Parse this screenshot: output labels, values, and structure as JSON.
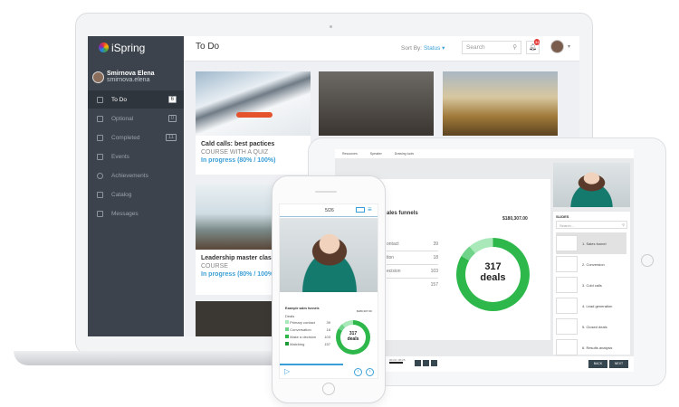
{
  "app": {
    "logo": "iSpring",
    "page_title": "To Do"
  },
  "user": {
    "name": "Smirnova Elena",
    "login": "smirnova.elena"
  },
  "sidebar": {
    "items": [
      {
        "label": "To Do",
        "count": "6",
        "icon": "clipboard-icon"
      },
      {
        "label": "Optional",
        "count": "0",
        "icon": "document-icon"
      },
      {
        "label": "Completed",
        "count": "11",
        "icon": "checkbox-icon"
      },
      {
        "label": "Events",
        "icon": "calendar-icon"
      },
      {
        "label": "Achievements",
        "icon": "medal-icon"
      },
      {
        "label": "Catalog",
        "icon": "catalog-icon"
      },
      {
        "label": "Messages",
        "icon": "envelope-icon"
      }
    ]
  },
  "header": {
    "sort_label": "Sort By:",
    "sort_value": "Status",
    "search_placeholder": "Search",
    "notifications": "34"
  },
  "cards": [
    {
      "title": "Cald calls: best pactices",
      "type": "COURSE WITH A QUIZ",
      "progress": "In progress (80% / 100%)"
    },
    {
      "title": "Leadership master class",
      "type": "COURSE",
      "progress": "In progress (80% / 100%)"
    }
  ],
  "tablet": {
    "tabs": [
      "Resources",
      "Speaker",
      "Drawing tools"
    ],
    "slide_title": "ales funnels",
    "amount": "$180,307.00",
    "rows": [
      {
        "label": "ontact",
        "value": "39"
      },
      {
        "label": "tion",
        "value": "18"
      },
      {
        "label": "ecision",
        "value": "103"
      },
      {
        "label": "",
        "value": "157"
      }
    ],
    "donut": {
      "number": "317",
      "label": "deals"
    },
    "slides_heading": "SLIDES",
    "slides_search": "Search...",
    "slides": [
      "1. Sales funnel",
      "2. Conversion",
      "3. Cold calls",
      "4. Lead generation",
      "5. Closed deals",
      "6. Results analysis"
    ],
    "time": "00:20 / 00:25",
    "back": "BACK",
    "next": "NEXT"
  },
  "phone": {
    "counter": "5/26",
    "slide_title": "Example sales funnels",
    "amount": "$180,307.00",
    "section": "Deals",
    "rows": [
      "Primary contact",
      "Conversation",
      "Make a decision",
      "Matching"
    ],
    "row_values": [
      "39",
      "18",
      "103",
      "157"
    ],
    "donut": {
      "number": "317",
      "label": "deals"
    }
  },
  "colors": {
    "sidebar": "#3c434c",
    "accent": "#3a9fd6",
    "green": "#2eb84b"
  }
}
